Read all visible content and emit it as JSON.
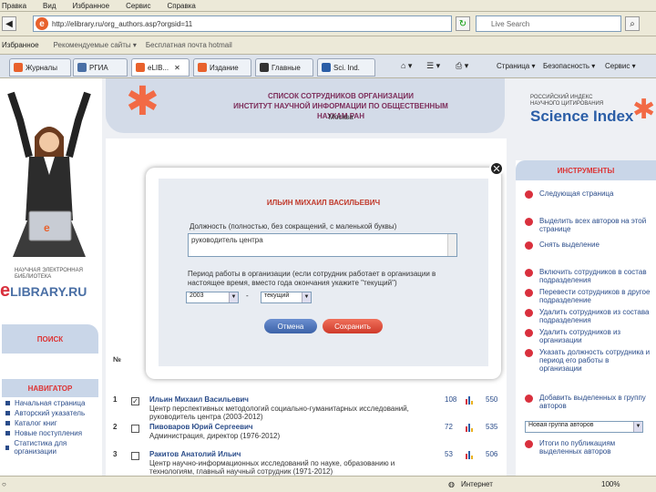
{
  "browser": {
    "menu": [
      "Правка",
      "Вид",
      "Избранное",
      "Сервис",
      "Справка"
    ],
    "url": "http://elibrary.ru/org_authors.asp?orgsid=11",
    "live_search_placeholder": "Live Search",
    "favorites": [
      "Избранное",
      "Рекомендуемые сайты ▾",
      "Бесплатная почта hotmail"
    ],
    "tabs": [
      "Журналы",
      "РГИА",
      "eLIB...",
      "Издание",
      "Главные",
      "Sci. Ind."
    ],
    "right_tools": [
      "Страница ▾",
      "Безопасность ▾",
      "Сервис ▾"
    ]
  },
  "header": {
    "title_line1": "СПИСОК СОТРУДНИКОВ ОРГАНИЗАЦИИ",
    "title_line2": "ИНСТИТУТ НАУЧНОЙ ИНФОРМАЦИИ ПО ОБЩЕСТВЕННЫМ НАУКАМ РАН",
    "city": "Москва",
    "index_line1": "РОССИЙСКИЙ ИНДЕКС",
    "index_line2": "НАУЧНОГО ЦИТИРОВАНИЯ",
    "index_name": "Science Index"
  },
  "left": {
    "logo_small": "НАУЧНАЯ ЭЛЕКТРОННАЯ БИБЛИОТЕКА",
    "logo_big": "LIBRARY.RU",
    "search_label": "ПОИСК",
    "navigator_label": "НАВИГАТОР",
    "nav_items": [
      "Начальная страница",
      "Авторский указатель",
      "Каталог книг",
      "Новые поступления",
      "Статистика для организации"
    ]
  },
  "tools": {
    "title": "ИНСТРУМЕНТЫ",
    "items": [
      "Следующая страница",
      "Выделить всех авторов на этой странице",
      "Снять выделение",
      "Включить сотрудников в состав подразделения",
      "Перевести сотрудников в другое подразделение",
      "Удалить сотрудников из состава подразделения",
      "Удалить сотрудников из организации",
      "Указать должность сотрудника и период его работы в организации",
      "Добавить выделенных в группу авторов",
      "Итоги по публикациям выделенных авторов"
    ],
    "select_value": "Новая группа авторов"
  },
  "table": {
    "num_header": "№",
    "rows": [
      {
        "n": "1",
        "checked": "✓",
        "name": "Ильин Михаил Васильевич",
        "desc": "Центр перспективных методологий социально-гуманитарных исследований, руководитель центра (2003-2012)",
        "c1": "108",
        "c2": "550"
      },
      {
        "n": "2",
        "checked": "",
        "name": "Пивоваров Юрий Сергеевич",
        "desc": "Администрация, директор (1976-2012)",
        "c1": "72",
        "c2": "535"
      },
      {
        "n": "3",
        "checked": "",
        "name": "Ракитов Анатолий Ильич",
        "desc": "Центр научно-информационных исследований по науке, образованию и технологиям, главный научный сотрудник (1971-2012)",
        "c1": "53",
        "c2": "506"
      }
    ]
  },
  "modal": {
    "person": "ИЛЬИН МИХАИЛ ВАСИЛЬЕВИЧ",
    "position_label": "Должность (полностью, без сокращений, с маленькой буквы)",
    "position_value": "руководитель центра",
    "period_label": "Период работы в организации (если сотрудник работает в организации в настоящее время, вместо года окончания укажите \"текущий\")",
    "year_from": "2003",
    "dash": "-",
    "year_to": "текущий",
    "cancel": "Отмена",
    "save": "Сохранить"
  },
  "status": {
    "zone": "Интернет",
    "zoom": "100%"
  },
  "colors": {
    "accent_red": "#d9303d",
    "brand_blue": "#2b5ea7"
  }
}
